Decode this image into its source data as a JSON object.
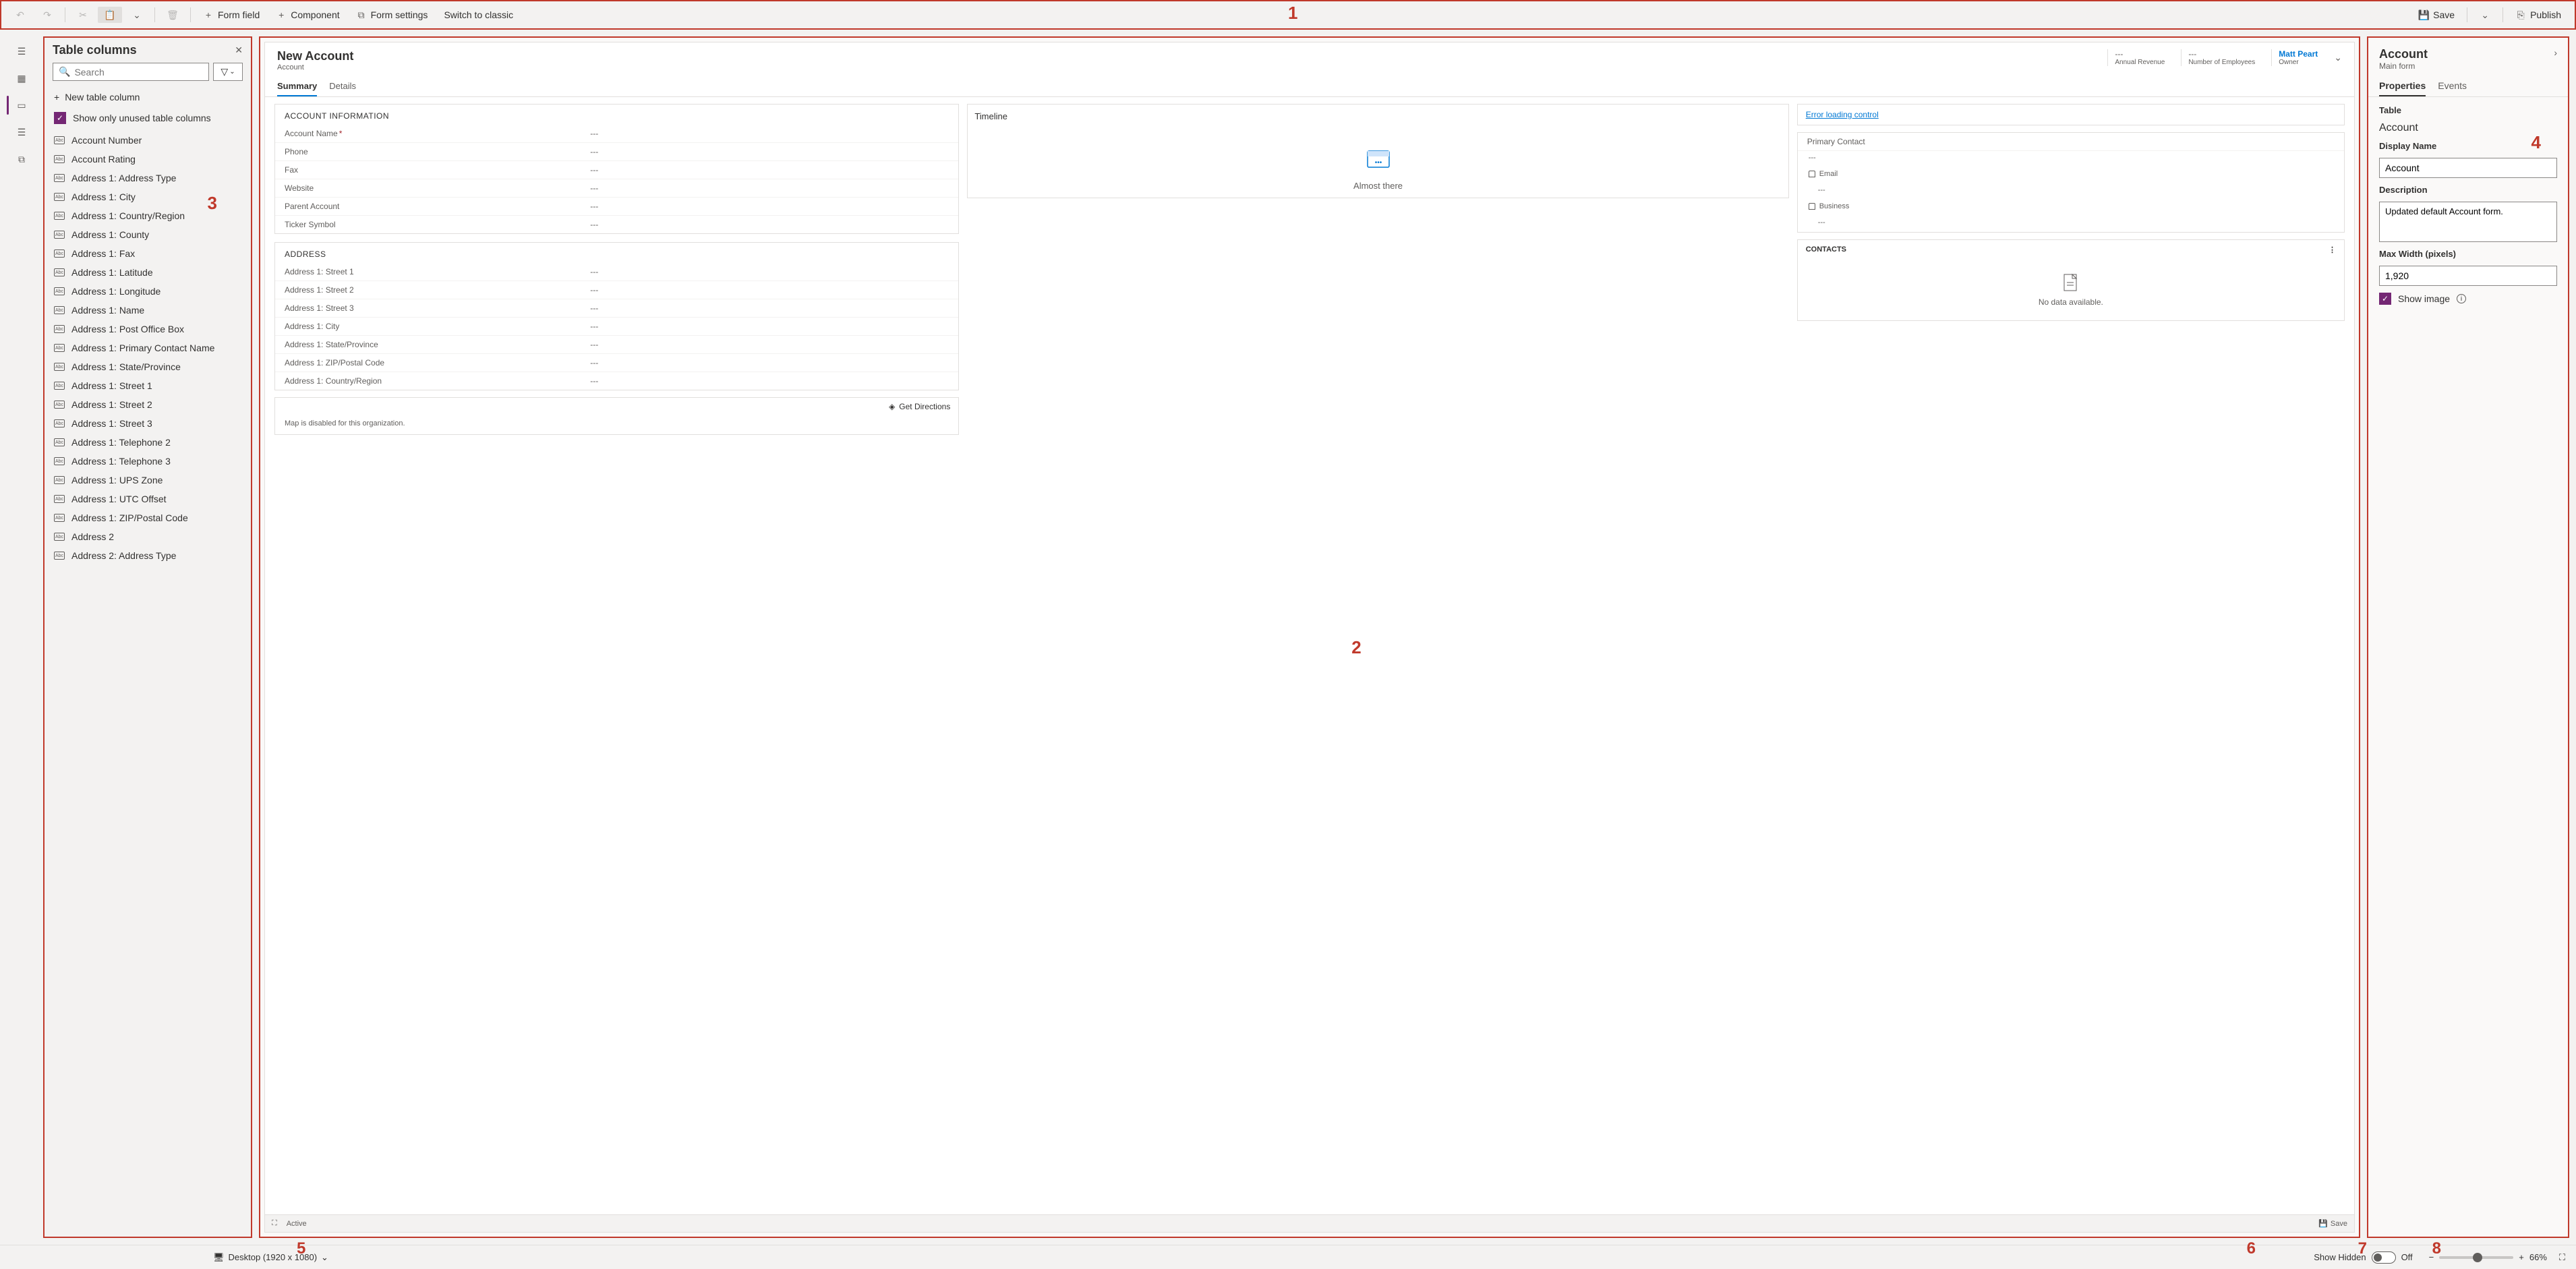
{
  "annotations": [
    "1",
    "2",
    "3",
    "4",
    "5",
    "6",
    "7",
    "8"
  ],
  "toolbar": {
    "form_field": "Form field",
    "component": "Component",
    "form_settings": "Form settings",
    "switch_classic": "Switch to classic",
    "save": "Save",
    "publish": "Publish"
  },
  "columns_panel": {
    "title": "Table columns",
    "search_placeholder": "Search",
    "new_column": "New table column",
    "show_unused": "Show only unused table columns",
    "items": [
      "Account Number",
      "Account Rating",
      "Address 1: Address Type",
      "Address 1: City",
      "Address 1: Country/Region",
      "Address 1: County",
      "Address 1: Fax",
      "Address 1: Latitude",
      "Address 1: Longitude",
      "Address 1: Name",
      "Address 1: Post Office Box",
      "Address 1: Primary Contact Name",
      "Address 1: State/Province",
      "Address 1: Street 1",
      "Address 1: Street 2",
      "Address 1: Street 3",
      "Address 1: Telephone 2",
      "Address 1: Telephone 3",
      "Address 1: UPS Zone",
      "Address 1: UTC Offset",
      "Address 1: ZIP/Postal Code",
      "Address 2",
      "Address 2: Address Type"
    ]
  },
  "canvas": {
    "form_title": "New Account",
    "entity": "Account",
    "header_fields": [
      {
        "value": "---",
        "label": "Annual Revenue"
      },
      {
        "value": "---",
        "label": "Number of Employees"
      }
    ],
    "owner_name": "Matt Peart",
    "owner_label": "Owner",
    "tabs": [
      "Summary",
      "Details"
    ],
    "account_info": {
      "title": "ACCOUNT INFORMATION",
      "fields": [
        {
          "label": "Account Name",
          "required": true,
          "value": "---"
        },
        {
          "label": "Phone",
          "value": "---"
        },
        {
          "label": "Fax",
          "value": "---"
        },
        {
          "label": "Website",
          "value": "---"
        },
        {
          "label": "Parent Account",
          "value": "---"
        },
        {
          "label": "Ticker Symbol",
          "value": "---"
        }
      ]
    },
    "address": {
      "title": "ADDRESS",
      "fields": [
        {
          "label": "Address 1: Street 1",
          "value": "---"
        },
        {
          "label": "Address 1: Street 2",
          "value": "---"
        },
        {
          "label": "Address 1: Street 3",
          "value": "---"
        },
        {
          "label": "Address 1: City",
          "value": "---"
        },
        {
          "label": "Address 1: State/Province",
          "value": "---"
        },
        {
          "label": "Address 1: ZIP/Postal Code",
          "value": "---"
        },
        {
          "label": "Address 1: Country/Region",
          "value": "---"
        }
      ]
    },
    "map": {
      "get_directions": "Get Directions",
      "disabled": "Map is disabled for this organization."
    },
    "timeline": {
      "title": "Timeline",
      "almost": "Almost there"
    },
    "error": "Error loading control",
    "primary_contact": {
      "title": "Primary Contact",
      "value": "---",
      "email": "Email",
      "email_val": "---",
      "business": "Business",
      "business_val": "---"
    },
    "contacts": {
      "title": "CONTACTS",
      "empty": "No data available."
    },
    "footer": {
      "status": "Active",
      "save": "Save"
    }
  },
  "properties": {
    "header_title": "Account",
    "header_sub": "Main form",
    "tabs": [
      "Properties",
      "Events"
    ],
    "table_label": "Table",
    "table_value": "Account",
    "display_name_label": "Display Name",
    "display_name_value": "Account",
    "description_label": "Description",
    "description_value": "Updated default Account form.",
    "max_width_label": "Max Width (pixels)",
    "max_width_value": "1,920",
    "show_image": "Show image"
  },
  "status_bar": {
    "device": "Desktop (1920 x 1080)",
    "show_hidden": "Show Hidden",
    "toggle_state": "Off",
    "zoom": "66%"
  }
}
